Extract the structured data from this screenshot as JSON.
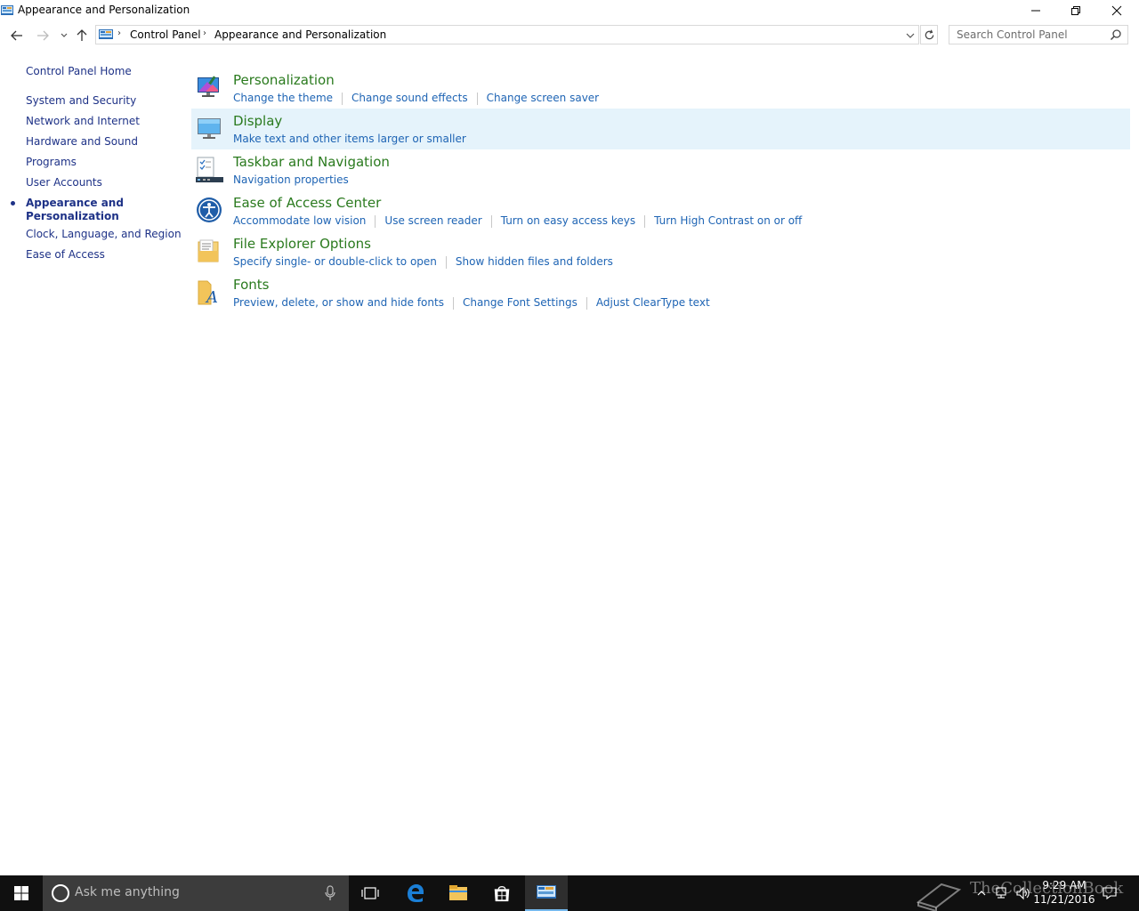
{
  "window": {
    "title": "Appearance and Personalization"
  },
  "address": {
    "crumbs": [
      "Control Panel",
      "Appearance and Personalization"
    ]
  },
  "search": {
    "placeholder": "Search Control Panel"
  },
  "leftnav": {
    "home": "Control Panel Home",
    "items": [
      "System and Security",
      "Network and Internet",
      "Hardware and Sound",
      "Programs",
      "User Accounts",
      "Appearance and Personalization",
      "Clock, Language, and Region",
      "Ease of Access"
    ],
    "current": "Appearance and Personalization"
  },
  "categories": [
    {
      "title": "Personalization",
      "icon": "personalization-icon",
      "links": [
        "Change the theme",
        "Change sound effects",
        "Change screen saver"
      ]
    },
    {
      "title": "Display",
      "icon": "display-icon",
      "links": [
        "Make text and other items larger or smaller"
      ]
    },
    {
      "title": "Taskbar and Navigation",
      "icon": "taskbar-icon",
      "links": [
        "Navigation properties"
      ]
    },
    {
      "title": "Ease of Access Center",
      "icon": "ease-of-access-icon",
      "links": [
        "Accommodate low vision",
        "Use screen reader",
        "Turn on easy access keys",
        "Turn High Contrast on or off"
      ]
    },
    {
      "title": "File Explorer Options",
      "icon": "folder-options-icon",
      "links": [
        "Specify single- or double-click to open",
        "Show hidden files and folders"
      ]
    },
    {
      "title": "Fonts",
      "icon": "fonts-icon",
      "links": [
        "Preview, delete, or show and hide fonts",
        "Change Font Settings",
        "Adjust ClearType text"
      ]
    }
  ],
  "taskbar": {
    "cortana_text": "Ask me anything",
    "time": "9:29 AM",
    "date": "11/21/2016",
    "watermark": "TheCollectionBook"
  },
  "colors": {
    "link": "#1e64b4",
    "category_title": "#2a7a1e",
    "nav_link": "#1e3287",
    "hover_row": "#e5f3fb",
    "taskbar": "#101010",
    "accent": "#76b9ed"
  }
}
